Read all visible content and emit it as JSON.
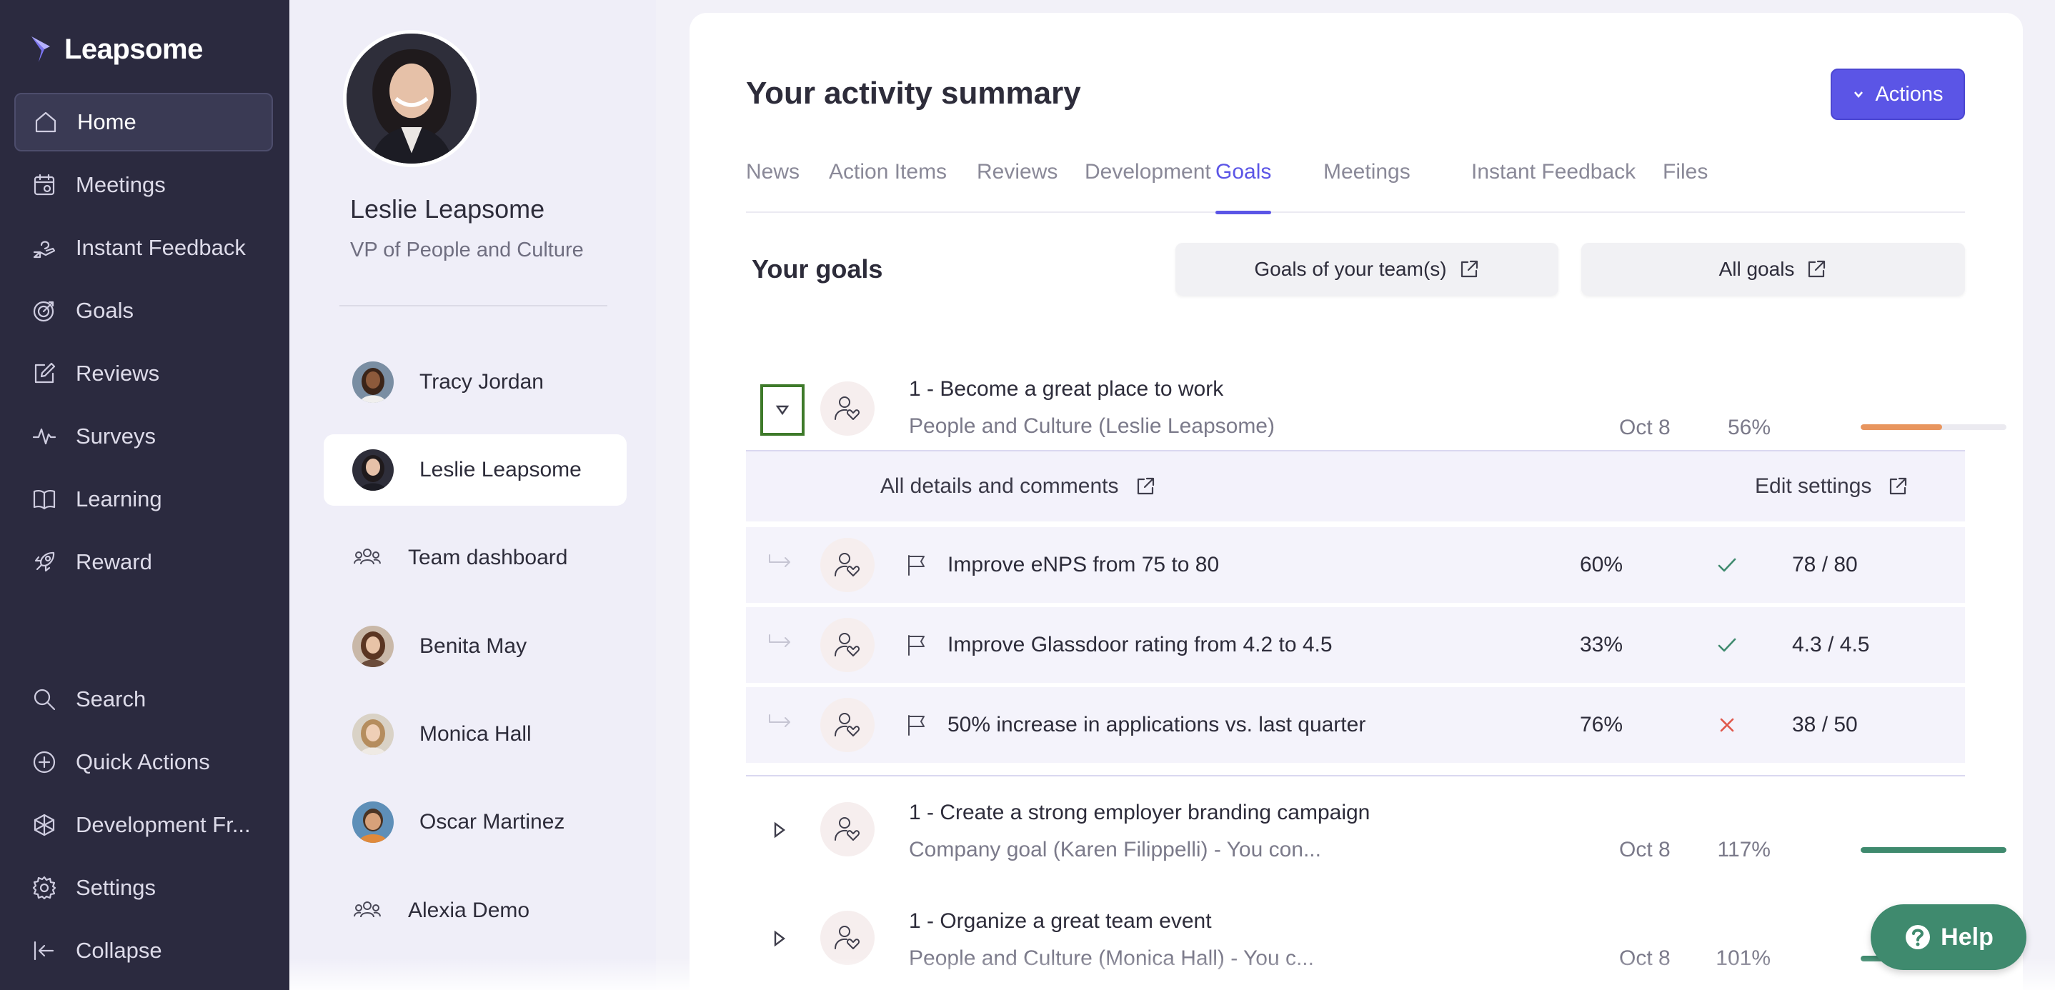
{
  "brand": {
    "name": "Leapsome"
  },
  "nav": {
    "items": [
      {
        "label": "Home",
        "icon": "home-icon"
      },
      {
        "label": "Meetings",
        "icon": "calendar-icon"
      },
      {
        "label": "Instant Feedback",
        "icon": "feedback-hand-icon"
      },
      {
        "label": "Goals",
        "icon": "target-icon"
      },
      {
        "label": "Reviews",
        "icon": "edit-square-icon"
      },
      {
        "label": "Surveys",
        "icon": "pulse-icon"
      },
      {
        "label": "Learning",
        "icon": "book-icon"
      },
      {
        "label": "Reward",
        "icon": "rocket-icon"
      }
    ],
    "bottom_items": [
      {
        "label": "Search",
        "icon": "search-icon"
      },
      {
        "label": "Quick Actions",
        "icon": "plus-circle-icon"
      },
      {
        "label": "Development Fr...",
        "icon": "framework-icon"
      },
      {
        "label": "Settings",
        "icon": "gear-icon"
      },
      {
        "label": "Collapse",
        "icon": "collapse-icon"
      }
    ]
  },
  "profile": {
    "name": "Leslie Leapsome",
    "role": "VP of People and Culture"
  },
  "people": [
    {
      "label": "Tracy Jordan",
      "type": "avatar"
    },
    {
      "label": "Leslie Leapsome",
      "type": "avatar"
    },
    {
      "label": "Team dashboard",
      "type": "team"
    },
    {
      "label": "Benita May",
      "type": "avatar"
    },
    {
      "label": "Monica Hall",
      "type": "avatar"
    },
    {
      "label": "Oscar Martinez",
      "type": "avatar"
    },
    {
      "label": "Alexia Demo",
      "type": "team"
    }
  ],
  "main": {
    "title": "Your activity summary",
    "actions_label": "Actions",
    "tabs": [
      "News",
      "Action Items",
      "Reviews",
      "Development",
      "Goals",
      "Meetings",
      "Instant Feedback",
      "Files"
    ],
    "active_tab": "Goals",
    "goals_title": "Your goals",
    "team_goals_label": "Goals of your team(s)",
    "all_goals_label": "All goals",
    "details_label": "All details and comments",
    "edit_settings_label": "Edit settings",
    "goals": [
      {
        "title": "1 - Become a great place to work",
        "subtitle": "People and Culture (Leslie Leapsome)",
        "date": "Oct 8",
        "percent": "56%",
        "progress": 0.56,
        "color": "#e8955e"
      },
      {
        "title": "1 - Create a strong employer branding campaign",
        "subtitle": "Company goal (Karen Filippelli) - You con...",
        "date": "Oct 8",
        "percent": "117%",
        "progress": 1.0,
        "color": "#3f8a6e"
      },
      {
        "title": "1 - Organize a great team event",
        "subtitle": "People and Culture (Monica Hall) - You c...",
        "date": "Oct 8",
        "percent": "101%",
        "progress": 1.0,
        "color": "#3f8a6e"
      }
    ],
    "key_results": [
      {
        "title": "Improve eNPS from 75 to 80",
        "percent": "60%",
        "status": "check",
        "value": "78 / 80"
      },
      {
        "title": "Improve Glassdoor rating from 4.2 to 4.5",
        "percent": "33%",
        "status": "check",
        "value": "4.3 / 4.5"
      },
      {
        "title": "50% increase in applications vs. last quarter",
        "percent": "76%",
        "status": "cross",
        "value": "38 / 50"
      }
    ]
  },
  "help": {
    "label": "Help"
  },
  "colors": {
    "accent": "#5b55e6",
    "nav_bg": "#2b2a3f",
    "success": "#3f8a6e",
    "warning": "#e8955e",
    "error": "#e0574a"
  }
}
